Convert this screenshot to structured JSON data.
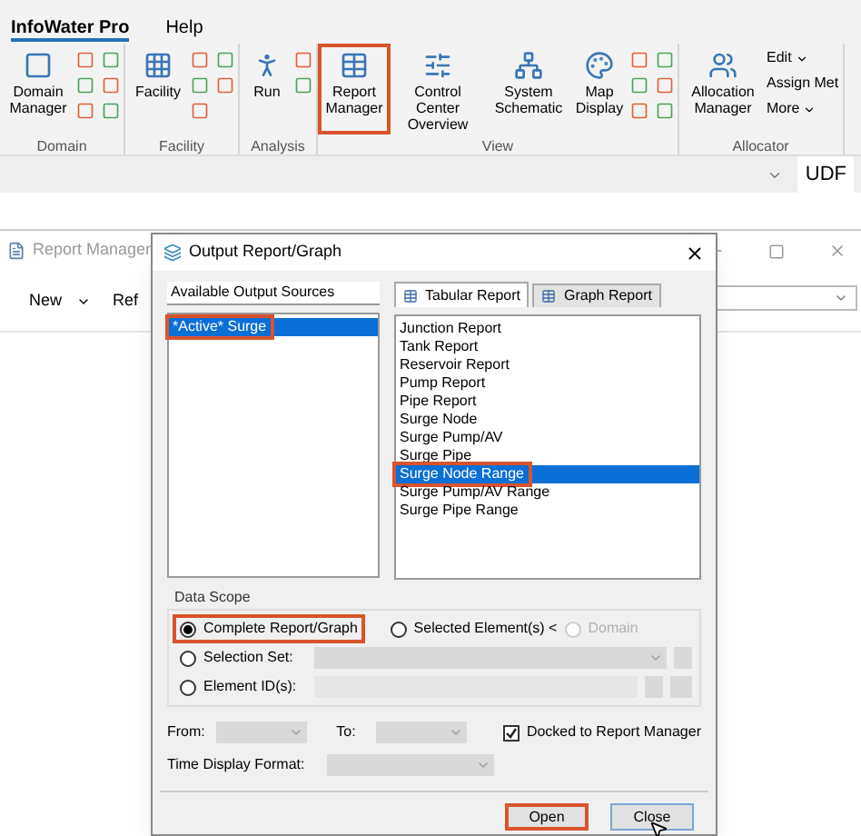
{
  "ribbon": {
    "tabs": [
      {
        "label": "InfoWater Pro",
        "selected": true
      },
      {
        "label": "Help",
        "selected": false
      }
    ],
    "groups": [
      {
        "label": "Domain",
        "buttons": [
          {
            "label": "Domain Manager",
            "highlighted": false
          }
        ]
      },
      {
        "label": "Facility",
        "buttons": [
          {
            "label": "Facility",
            "highlighted": false
          }
        ]
      },
      {
        "label": "Analysis",
        "buttons": [
          {
            "label": "Run",
            "highlighted": false
          }
        ]
      },
      {
        "label": "View",
        "buttons": [
          {
            "label": "Report Manager",
            "highlighted": true
          },
          {
            "label": "Control Center Overview",
            "highlighted": false
          },
          {
            "label": "System Schematic",
            "highlighted": false
          },
          {
            "label": "Map Display",
            "highlighted": false
          }
        ]
      },
      {
        "label": "Allocator",
        "buttons": [
          {
            "label": "Allocation Manager",
            "highlighted": false
          }
        ],
        "menu": [
          {
            "label": "Edit",
            "dropdown": true
          },
          {
            "label": "Assign Met",
            "dropdown": false
          },
          {
            "label": "More",
            "dropdown": true
          }
        ]
      }
    ]
  },
  "tool_bar": {
    "label": "UDF"
  },
  "report_manager": {
    "title": "Report Manager",
    "toolbar": [
      {
        "label": "New",
        "dropdown": true
      },
      {
        "label": "Ref",
        "dropdown": false
      }
    ]
  },
  "dialog": {
    "title": "Output Report/Graph",
    "sources": {
      "header": "Available Output Sources",
      "items": [
        {
          "label": "*Active* Surge",
          "selected": true,
          "highlighted": true
        }
      ]
    },
    "tabs": [
      {
        "label": "Tabular Report",
        "selected": true
      },
      {
        "label": "Graph Report",
        "selected": false
      }
    ],
    "reports": [
      {
        "label": "Junction Report",
        "selected": false,
        "highlighted": false
      },
      {
        "label": "Tank Report",
        "selected": false,
        "highlighted": false
      },
      {
        "label": "Reservoir Report",
        "selected": false,
        "highlighted": false
      },
      {
        "label": "Pump Report",
        "selected": false,
        "highlighted": false
      },
      {
        "label": "Pipe Report",
        "selected": false,
        "highlighted": false
      },
      {
        "label": "Surge Node",
        "selected": false,
        "highlighted": false
      },
      {
        "label": "Surge Pump/AV",
        "selected": false,
        "highlighted": false
      },
      {
        "label": "Surge Pipe",
        "selected": false,
        "highlighted": false
      },
      {
        "label": "Surge Node Range",
        "selected": true,
        "highlighted": true
      },
      {
        "label": "Surge Pump/AV Range",
        "selected": false,
        "highlighted": false
      },
      {
        "label": "Surge Pipe Range",
        "selected": false,
        "highlighted": false
      }
    ],
    "data_scope": {
      "label": "Data Scope",
      "options": [
        {
          "label": "Complete Report/Graph",
          "selected": true,
          "disabled": false,
          "highlighted": true
        },
        {
          "label": "Selected Element(s) <",
          "selected": false,
          "disabled": false,
          "highlighted": false
        },
        {
          "label": "Domain",
          "selected": false,
          "disabled": true,
          "highlighted": false
        },
        {
          "label": "Selection Set:",
          "selected": false,
          "disabled": false,
          "highlighted": false
        },
        {
          "label": "Element ID(s):",
          "selected": false,
          "disabled": false,
          "highlighted": false
        }
      ]
    },
    "from_label": "From:",
    "to_label": "To:",
    "docked": {
      "label": "Docked to Report Manager",
      "checked": true
    },
    "time_format_label": "Time Display Format:",
    "buttons": [
      {
        "label": "Open",
        "highlighted": true
      },
      {
        "label": "Close",
        "highlighted": false
      }
    ]
  }
}
